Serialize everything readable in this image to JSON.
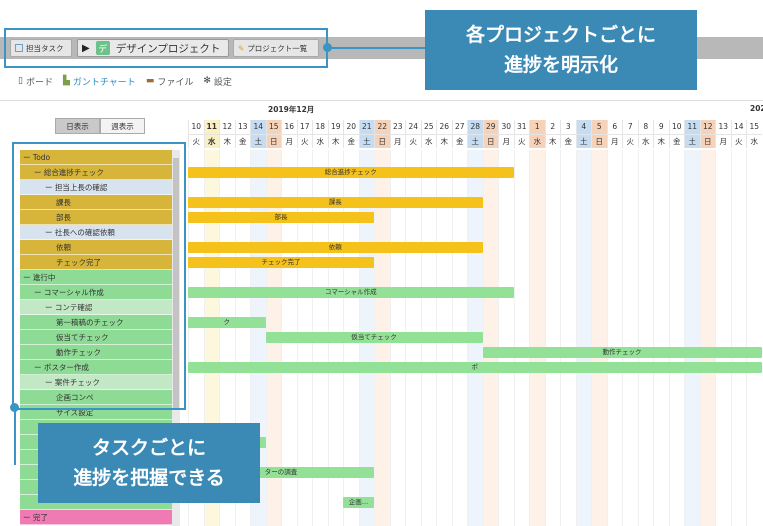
{
  "project_tabs": {
    "task_tab": "担当タスク",
    "design_tab": "デザインプロジェクト",
    "design_badge": "デ",
    "list_tab": "プロジェクト一覧"
  },
  "views": {
    "board": "ボード",
    "gantt": "ガントチャート",
    "file": "ファイル",
    "settings": "設定"
  },
  "day_mode": {
    "day": "日表示",
    "week": "週表示"
  },
  "months": {
    "dec": "2019年12月",
    "next": "202"
  },
  "days": [
    {
      "n": "10",
      "w": "火",
      "t": ""
    },
    {
      "n": "11",
      "w": "水",
      "t": "today"
    },
    {
      "n": "12",
      "w": "木",
      "t": ""
    },
    {
      "n": "13",
      "w": "金",
      "t": ""
    },
    {
      "n": "14",
      "w": "土",
      "t": "sat"
    },
    {
      "n": "15",
      "w": "日",
      "t": "sun"
    },
    {
      "n": "16",
      "w": "月",
      "t": ""
    },
    {
      "n": "17",
      "w": "火",
      "t": ""
    },
    {
      "n": "18",
      "w": "水",
      "t": ""
    },
    {
      "n": "19",
      "w": "木",
      "t": ""
    },
    {
      "n": "20",
      "w": "金",
      "t": ""
    },
    {
      "n": "21",
      "w": "土",
      "t": "sat"
    },
    {
      "n": "22",
      "w": "日",
      "t": "sun"
    },
    {
      "n": "23",
      "w": "月",
      "t": ""
    },
    {
      "n": "24",
      "w": "火",
      "t": ""
    },
    {
      "n": "25",
      "w": "水",
      "t": ""
    },
    {
      "n": "26",
      "w": "木",
      "t": ""
    },
    {
      "n": "27",
      "w": "金",
      "t": ""
    },
    {
      "n": "28",
      "w": "土",
      "t": "sat"
    },
    {
      "n": "29",
      "w": "日",
      "t": "sun"
    },
    {
      "n": "30",
      "w": "月",
      "t": ""
    },
    {
      "n": "31",
      "w": "火",
      "t": ""
    },
    {
      "n": "1",
      "w": "水",
      "t": "sun"
    },
    {
      "n": "2",
      "w": "木",
      "t": ""
    },
    {
      "n": "3",
      "w": "金",
      "t": ""
    },
    {
      "n": "4",
      "w": "土",
      "t": "sat"
    },
    {
      "n": "5",
      "w": "日",
      "t": "sun"
    },
    {
      "n": "6",
      "w": "月",
      "t": ""
    },
    {
      "n": "7",
      "w": "火",
      "t": ""
    },
    {
      "n": "8",
      "w": "水",
      "t": ""
    },
    {
      "n": "9",
      "w": "木",
      "t": ""
    },
    {
      "n": "10",
      "w": "金",
      "t": ""
    },
    {
      "n": "11",
      "w": "土",
      "t": "sat"
    },
    {
      "n": "12",
      "w": "日",
      "t": "sun"
    },
    {
      "n": "13",
      "w": "月",
      "t": ""
    },
    {
      "n": "14",
      "w": "火",
      "t": ""
    },
    {
      "n": "15",
      "w": "水",
      "t": ""
    }
  ],
  "tasks": [
    {
      "label": "ー Todo",
      "c": "c-todo-y",
      "indent": 0
    },
    {
      "label": "ー 総合進捗チェック",
      "c": "c-todo-y",
      "indent": 1
    },
    {
      "label": "ー 担当上長の確認",
      "c": "c-todo-b",
      "indent": 2
    },
    {
      "label": "課長",
      "c": "c-todo-y",
      "indent": 3
    },
    {
      "label": "部長",
      "c": "c-todo-y",
      "indent": 3
    },
    {
      "label": "ー 社長への確認依頼",
      "c": "c-todo-b",
      "indent": 2
    },
    {
      "label": "依頼",
      "c": "c-todo-y",
      "indent": 3
    },
    {
      "label": "チェック完了",
      "c": "c-todo-y",
      "indent": 3
    },
    {
      "label": "ー 進行中",
      "c": "c-green",
      "indent": 0
    },
    {
      "label": "ー コマーシャル作成",
      "c": "c-green",
      "indent": 1
    },
    {
      "label": "ー コンテ確認",
      "c": "c-green-l",
      "indent": 2
    },
    {
      "label": "第一稿稿のチェック",
      "c": "c-green",
      "indent": 3
    },
    {
      "label": "仮当てチェック",
      "c": "c-green",
      "indent": 3
    },
    {
      "label": "動作チェック",
      "c": "c-green",
      "indent": 3
    },
    {
      "label": "ー ポスター作成",
      "c": "c-green",
      "indent": 1
    },
    {
      "label": "ー 案件チェック",
      "c": "c-green-l",
      "indent": 2
    },
    {
      "label": "企画コンペ",
      "c": "c-green",
      "indent": 3
    },
    {
      "label": "サイズ設定",
      "c": "c-green",
      "indent": 3
    },
    {
      "label": "",
      "c": "c-green",
      "indent": 3
    },
    {
      "label": "",
      "c": "c-green",
      "indent": 3
    },
    {
      "label": "",
      "c": "c-green",
      "indent": 3
    },
    {
      "label": "",
      "c": "c-green",
      "indent": 3
    },
    {
      "label": "",
      "c": "c-green",
      "indent": 3
    },
    {
      "label": "",
      "c": "c-green",
      "indent": 3
    },
    {
      "label": "ー 完了",
      "c": "c-pink",
      "indent": 0
    }
  ],
  "bars": [
    {
      "label": "総合進捗チェック",
      "row": 1,
      "start": 0,
      "end": 21,
      "c": "y"
    },
    {
      "label": "課長",
      "row": 3,
      "start": 0,
      "end": 19,
      "c": "y"
    },
    {
      "label": "部長",
      "row": 4,
      "start": 0,
      "end": 12,
      "c": "y"
    },
    {
      "label": "依頼",
      "row": 6,
      "start": 0,
      "end": 19,
      "c": "y"
    },
    {
      "label": "チェック完了",
      "row": 7,
      "start": 0,
      "end": 12,
      "c": "y"
    },
    {
      "label": "コマーシャル作成",
      "row": 9,
      "start": 0,
      "end": 21,
      "c": "g"
    },
    {
      "label": "ク",
      "row": 11,
      "start": 0,
      "end": 5,
      "c": "g"
    },
    {
      "label": "仮当てチェック",
      "row": 12,
      "start": 5,
      "end": 19,
      "c": "g"
    },
    {
      "label": "動作チェック",
      "row": 13,
      "start": 19,
      "end": 37,
      "c": "g"
    },
    {
      "label": "ポ",
      "row": 14,
      "start": 0,
      "end": 37,
      "c": "g"
    },
    {
      "label": "",
      "row": 19,
      "start": 0,
      "end": 5,
      "c": "g"
    },
    {
      "label": "ターの調査",
      "row": 21,
      "start": 0,
      "end": 12,
      "c": "g"
    },
    {
      "label": "企画…",
      "row": 23,
      "start": 10,
      "end": 12,
      "c": "g"
    }
  ],
  "callouts": {
    "top_line1": "各プロジェクトごとに",
    "top_line2": "進捗を明示化",
    "left_line1": "タスクごとに",
    "left_line2": "進捗を把握できる"
  }
}
